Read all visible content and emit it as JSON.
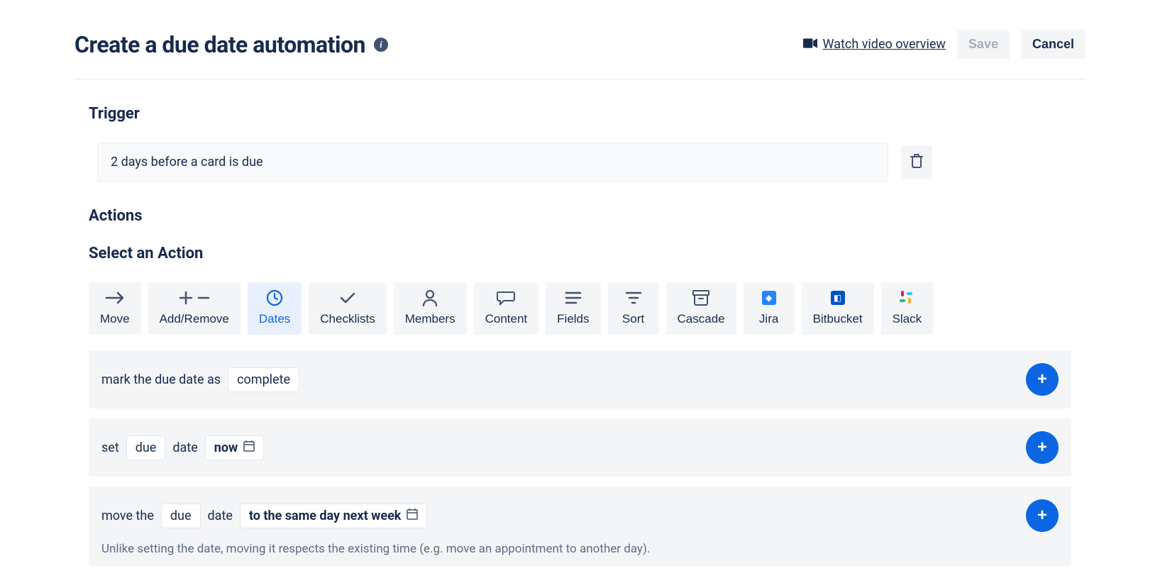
{
  "header": {
    "title": "Create a due date automation",
    "video_link": "Watch video overview",
    "save_label": "Save",
    "cancel_label": "Cancel"
  },
  "trigger": {
    "heading": "Trigger",
    "text": "2 days before a card is due"
  },
  "actions": {
    "heading": "Actions",
    "select_heading": "Select an Action",
    "tabs": [
      {
        "label": "Move",
        "icon": "arrow-right"
      },
      {
        "label": "Add/Remove",
        "icon": "plus-minus"
      },
      {
        "label": "Dates",
        "icon": "clock",
        "active": true
      },
      {
        "label": "Checklists",
        "icon": "check"
      },
      {
        "label": "Members",
        "icon": "person"
      },
      {
        "label": "Content",
        "icon": "speech"
      },
      {
        "label": "Fields",
        "icon": "lines"
      },
      {
        "label": "Sort",
        "icon": "filter"
      },
      {
        "label": "Cascade",
        "icon": "archive"
      },
      {
        "label": "Jira",
        "icon": "jira"
      },
      {
        "label": "Bitbucket",
        "icon": "bitbucket"
      },
      {
        "label": "Slack",
        "icon": "slack"
      }
    ],
    "row1": {
      "prefix": "mark the due date as",
      "chip": "complete"
    },
    "row2": {
      "w1": "set",
      "chip1": "due",
      "w2": "date",
      "chip2": "now"
    },
    "row3": {
      "w1": "move the",
      "chip1": "due",
      "w2": "date",
      "chip2": "to the same day next week",
      "note": "Unlike setting the date, moving it respects the existing time (e.g. move an appointment to another day)."
    }
  }
}
